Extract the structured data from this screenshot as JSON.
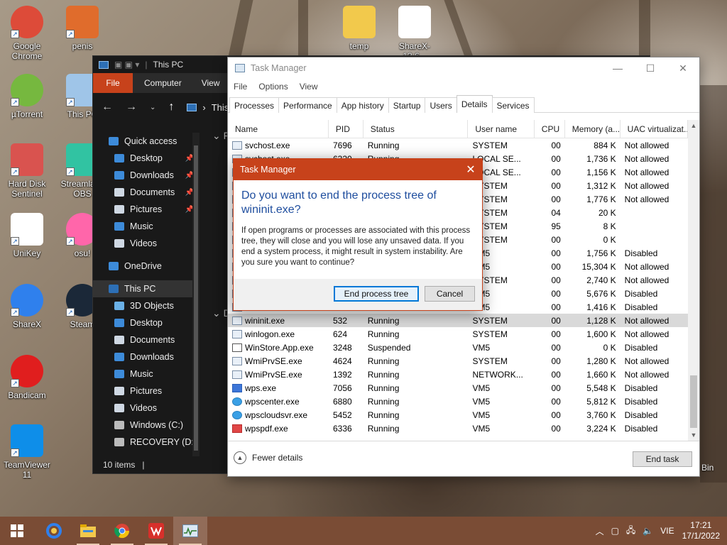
{
  "desktop": {
    "icons": [
      {
        "label": "Google Chrome",
        "icon": "chrome-icon",
        "color": "#dd4b39"
      },
      {
        "label": "penis",
        "icon": "wps-presentation-file-icon",
        "color": "#e06c2c"
      },
      {
        "label": "temp",
        "icon": "folder-icon",
        "color": "#f2c94c"
      },
      {
        "label": "ShareX-13.6...",
        "icon": "installer-icon",
        "color": "#ffffff"
      },
      {
        "label": "µTorrent",
        "icon": "utorrent-icon",
        "color": "#76b83f"
      },
      {
        "label": "This PC",
        "icon": "this-pc-icon",
        "color": "#9fc5e8"
      },
      {
        "label": "Hard Disk Sentinel",
        "icon": "hard-disk-sentinel-icon",
        "color": "#d9534f"
      },
      {
        "label": "Streamlabs OBS",
        "icon": "streamlabs-obs-icon",
        "color": "#31c3a2"
      },
      {
        "label": "UniKey",
        "icon": "unikey-icon",
        "color": "#ffffff"
      },
      {
        "label": "osu!",
        "icon": "osu-icon",
        "color": "#ff66aa"
      },
      {
        "label": "ShareX",
        "icon": "sharex-icon",
        "color": "#2f80ed"
      },
      {
        "label": "Steam",
        "icon": "steam-icon",
        "color": "#1b2838"
      },
      {
        "label": "Bandicam",
        "icon": "bandicam-icon",
        "color": "#e01e1e"
      },
      {
        "label": "TeamViewer 11",
        "icon": "teamviewer-icon",
        "color": "#0e8ee9"
      }
    ],
    "recycle_bin_label": "Bin"
  },
  "explorer": {
    "title": "This PC",
    "ribbon": {
      "file": "File",
      "computer": "Computer",
      "view": "View"
    },
    "address": "This PC",
    "tree": [
      {
        "label": "Quick access",
        "icon": "star-icon",
        "pinned": false
      },
      {
        "label": "Desktop",
        "icon": "desktop-folder-icon",
        "pinned": true
      },
      {
        "label": "Downloads",
        "icon": "downloads-icon",
        "pinned": true
      },
      {
        "label": "Documents",
        "icon": "documents-icon",
        "pinned": true
      },
      {
        "label": "Pictures",
        "icon": "pictures-icon",
        "pinned": true
      },
      {
        "label": "Music",
        "icon": "music-icon",
        "pinned": false
      },
      {
        "label": "Videos",
        "icon": "videos-icon",
        "pinned": false
      },
      {
        "label": "OneDrive",
        "icon": "onedrive-icon",
        "pinned": false
      },
      {
        "label": "This PC",
        "icon": "this-pc-icon",
        "pinned": false
      },
      {
        "label": "3D Objects",
        "icon": "3d-objects-icon",
        "pinned": false
      },
      {
        "label": "Desktop",
        "icon": "desktop-folder-icon",
        "pinned": false
      },
      {
        "label": "Documents",
        "icon": "documents-icon",
        "pinned": false
      },
      {
        "label": "Downloads",
        "icon": "downloads-icon",
        "pinned": false
      },
      {
        "label": "Music",
        "icon": "music-icon",
        "pinned": false
      },
      {
        "label": "Pictures",
        "icon": "pictures-icon",
        "pinned": false
      },
      {
        "label": "Videos",
        "icon": "videos-icon",
        "pinned": false
      },
      {
        "label": "Windows (C:)",
        "icon": "drive-c-icon",
        "pinned": false
      },
      {
        "label": "RECOVERY (D:)",
        "icon": "drive-d-icon",
        "pinned": false
      }
    ],
    "status": "10 items",
    "content_fragment_1": "Fo",
    "content_fragment_2": "D"
  },
  "task_manager": {
    "title": "Task Manager",
    "window_buttons": {
      "minimize": "—",
      "maximize": "☐",
      "close": "✕"
    },
    "menu": [
      "File",
      "Options",
      "View"
    ],
    "tabs": [
      "Processes",
      "Performance",
      "App history",
      "Startup",
      "Users",
      "Details",
      "Services"
    ],
    "active_tab": "Details",
    "columns": [
      "Name",
      "PID",
      "Status",
      "User name",
      "CPU",
      "Memory (a...",
      "UAC virtualizat..."
    ],
    "rows": [
      {
        "name": "svchost.exe",
        "pid": "7696",
        "status": "Running",
        "user": "SYSTEM",
        "cpu": "00",
        "memory": "884 K",
        "uac": "Not allowed",
        "icon": "process-icon"
      },
      {
        "name": "svchost.exe",
        "pid": "6320",
        "status": "Running",
        "user": "LOCAL SE...",
        "cpu": "00",
        "memory": "1,736 K",
        "uac": "Not allowed",
        "icon": "process-icon"
      },
      {
        "name": "",
        "pid": "",
        "status": "",
        "user": "LOCAL SE...",
        "cpu": "00",
        "memory": "1,156 K",
        "uac": "Not allowed",
        "icon": "process-icon"
      },
      {
        "name": "",
        "pid": "",
        "status": "",
        "user": "SYSTEM",
        "cpu": "00",
        "memory": "1,312 K",
        "uac": "Not allowed",
        "icon": "process-icon"
      },
      {
        "name": "",
        "pid": "",
        "status": "",
        "user": "SYSTEM",
        "cpu": "00",
        "memory": "1,776 K",
        "uac": "Not allowed",
        "icon": "process-icon"
      },
      {
        "name": "",
        "pid": "",
        "status": "",
        "user": "SYSTEM",
        "cpu": "04",
        "memory": "20 K",
        "uac": "",
        "icon": "process-icon"
      },
      {
        "name": "",
        "pid": "",
        "status": "",
        "user": "SYSTEM",
        "cpu": "95",
        "memory": "8 K",
        "uac": "",
        "icon": "process-icon"
      },
      {
        "name": "",
        "pid": "",
        "status": "",
        "user": "SYSTEM",
        "cpu": "00",
        "memory": "0 K",
        "uac": "",
        "icon": "process-icon"
      },
      {
        "name": "",
        "pid": "",
        "status": "",
        "user": "VM5",
        "cpu": "00",
        "memory": "1,756 K",
        "uac": "Disabled",
        "icon": "process-icon"
      },
      {
        "name": "",
        "pid": "",
        "status": "",
        "user": "VM5",
        "cpu": "00",
        "memory": "15,304 K",
        "uac": "Not allowed",
        "icon": "process-icon"
      },
      {
        "name": "",
        "pid": "",
        "status": "",
        "user": "SYSTEM",
        "cpu": "00",
        "memory": "2,740 K",
        "uac": "Not allowed",
        "icon": "process-icon"
      },
      {
        "name": "",
        "pid": "",
        "status": "",
        "user": "VM5",
        "cpu": "00",
        "memory": "5,676 K",
        "uac": "Disabled",
        "icon": "process-icon"
      },
      {
        "name": "",
        "pid": "",
        "status": "",
        "user": "VM5",
        "cpu": "00",
        "memory": "1,416 K",
        "uac": "Disabled",
        "icon": "process-icon"
      },
      {
        "name": "wininit.exe",
        "pid": "532",
        "status": "Running",
        "user": "SYSTEM",
        "cpu": "00",
        "memory": "1,128 K",
        "uac": "Not allowed",
        "icon": "process-icon",
        "selected": true
      },
      {
        "name": "winlogon.exe",
        "pid": "624",
        "status": "Running",
        "user": "SYSTEM",
        "cpu": "00",
        "memory": "1,600 K",
        "uac": "Not allowed",
        "icon": "process-icon"
      },
      {
        "name": "WinStore.App.exe",
        "pid": "3248",
        "status": "Suspended",
        "user": "VM5",
        "cpu": "00",
        "memory": "0 K",
        "uac": "Disabled",
        "icon": "store-icon"
      },
      {
        "name": "WmiPrvSE.exe",
        "pid": "4624",
        "status": "Running",
        "user": "SYSTEM",
        "cpu": "00",
        "memory": "1,280 K",
        "uac": "Not allowed",
        "icon": "process-icon"
      },
      {
        "name": "WmiPrvSE.exe",
        "pid": "1392",
        "status": "Running",
        "user": "NETWORK...",
        "cpu": "00",
        "memory": "1,660 K",
        "uac": "Not allowed",
        "icon": "process-icon"
      },
      {
        "name": "wps.exe",
        "pid": "7056",
        "status": "Running",
        "user": "VM5",
        "cpu": "00",
        "memory": "5,548 K",
        "uac": "Disabled",
        "icon": "wps-icon"
      },
      {
        "name": "wpscenter.exe",
        "pid": "6880",
        "status": "Running",
        "user": "VM5",
        "cpu": "00",
        "memory": "5,812 K",
        "uac": "Disabled",
        "icon": "wps-cloud-icon"
      },
      {
        "name": "wpscloudsvr.exe",
        "pid": "5452",
        "status": "Running",
        "user": "VM5",
        "cpu": "00",
        "memory": "3,760 K",
        "uac": "Disabled",
        "icon": "wps-cloud-icon"
      },
      {
        "name": "wpspdf.exe",
        "pid": "6336",
        "status": "Running",
        "user": "VM5",
        "cpu": "00",
        "memory": "3,224 K",
        "uac": "Disabled",
        "icon": "wps-pdf-icon"
      }
    ],
    "fewer_details": "Fewer details",
    "end_task": "End task"
  },
  "dialog": {
    "title": "Task Manager",
    "question": "Do you want to end the process tree of wininit.exe?",
    "body": "If open programs or processes are associated with this process tree, they will close and you will lose any unsaved data. If you end a system process, it might result in system instability. Are you sure you want to continue?",
    "primary_button": "End process tree",
    "cancel_button": "Cancel",
    "accent_color": "#c7421b"
  },
  "taskbar": {
    "apps": [
      {
        "name": "start",
        "icon": "windows-start-icon"
      },
      {
        "name": "sharex",
        "icon": "sharex-icon"
      },
      {
        "name": "file-explorer",
        "icon": "file-explorer-icon"
      },
      {
        "name": "chrome",
        "icon": "chrome-icon"
      },
      {
        "name": "wps-office",
        "icon": "wps-office-icon"
      },
      {
        "name": "task-manager",
        "icon": "task-manager-icon"
      }
    ],
    "language": "VIE",
    "time": "17:21",
    "date": "17/1/2022"
  }
}
